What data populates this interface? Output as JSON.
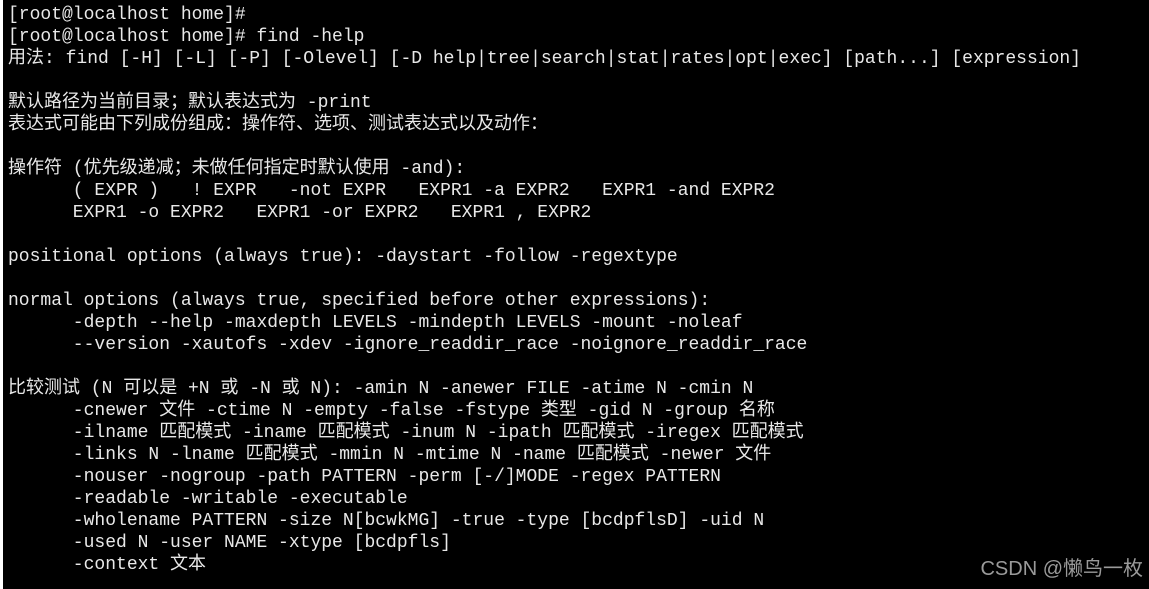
{
  "terminal": {
    "lines": [
      "[root@localhost home]#",
      "[root@localhost home]# find -help",
      "用法: find [-H] [-L] [-P] [-Olevel] [-D help|tree|search|stat|rates|opt|exec] [path...] [expression]",
      "",
      "默认路径为当前目录；默认表达式为 -print",
      "表达式可能由下列成份组成：操作符、选项、测试表达式以及动作：",
      "",
      "操作符 (优先级递减；未做任何指定时默认使用 -and):",
      "      ( EXPR )   ! EXPR   -not EXPR   EXPR1 -a EXPR2   EXPR1 -and EXPR2",
      "      EXPR1 -o EXPR2   EXPR1 -or EXPR2   EXPR1 , EXPR2",
      "",
      "positional options (always true): -daystart -follow -regextype",
      "",
      "normal options (always true, specified before other expressions):",
      "      -depth --help -maxdepth LEVELS -mindepth LEVELS -mount -noleaf",
      "      --version -xautofs -xdev -ignore_readdir_race -noignore_readdir_race",
      "",
      "比较测试 (N 可以是 +N 或 -N 或 N): -amin N -anewer FILE -atime N -cmin N",
      "      -cnewer 文件 -ctime N -empty -false -fstype 类型 -gid N -group 名称",
      "      -ilname 匹配模式 -iname 匹配模式 -inum N -ipath 匹配模式 -iregex 匹配模式",
      "      -links N -lname 匹配模式 -mmin N -mtime N -name 匹配模式 -newer 文件",
      "      -nouser -nogroup -path PATTERN -perm [-/]MODE -regex PATTERN",
      "      -readable -writable -executable",
      "      -wholename PATTERN -size N[bcwkMG] -true -type [bcdpflsD] -uid N",
      "      -used N -user NAME -xtype [bcdpfls]",
      "      -context 文本"
    ]
  },
  "watermark": "CSDN @懒鸟一枚"
}
